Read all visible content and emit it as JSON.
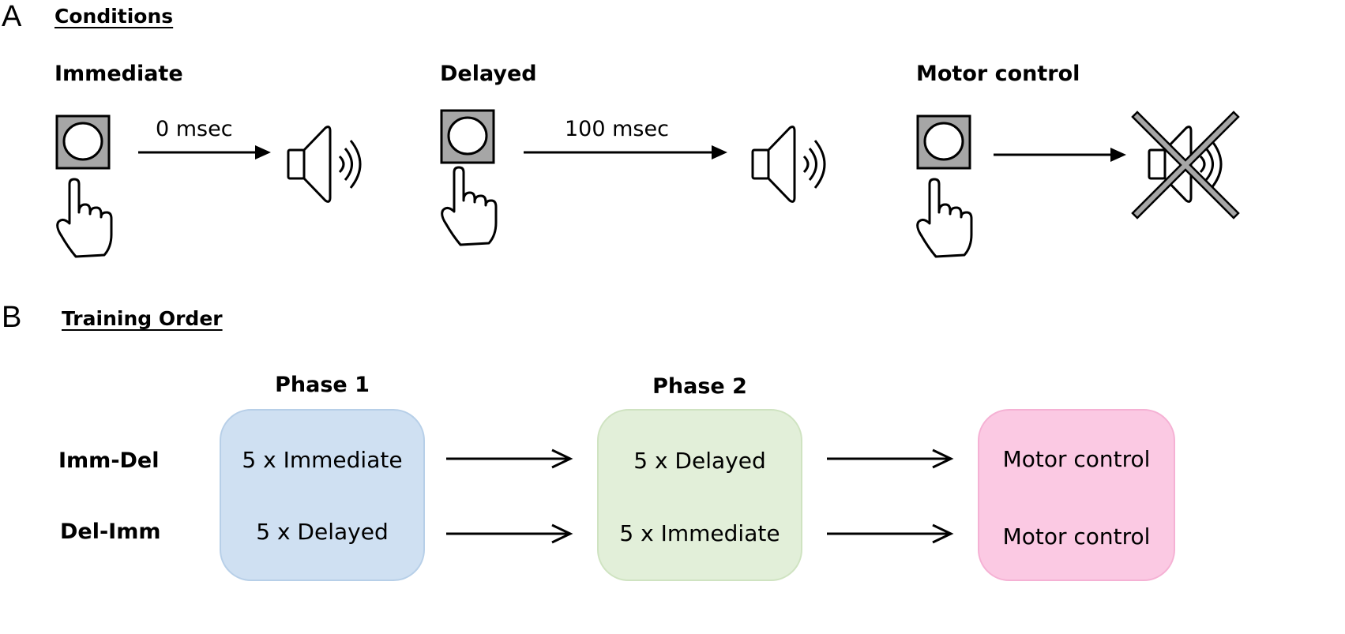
{
  "panel_a": {
    "letter": "A",
    "title": "Conditions",
    "conditions": [
      {
        "title": "Immediate",
        "delay_label": "0 msec",
        "button_icon": "button-icon",
        "hand_icon": "pointing-hand-icon",
        "output_icon": "speaker-icon",
        "sound_muted": false
      },
      {
        "title": "Delayed",
        "delay_label": "100 msec",
        "button_icon": "button-icon",
        "hand_icon": "pointing-hand-icon",
        "output_icon": "speaker-icon",
        "sound_muted": false
      },
      {
        "title": "Motor control",
        "delay_label": "",
        "button_icon": "button-icon",
        "hand_icon": "pointing-hand-icon",
        "output_icon": "speaker-muted-icon",
        "sound_muted": true
      }
    ]
  },
  "panel_b": {
    "letter": "B",
    "title": "Training Order",
    "phases": [
      {
        "title": "Phase 1",
        "color": "#cfe0f2",
        "border": "#b7cfe8",
        "rows": [
          "5 x Immediate",
          "5 x Delayed"
        ]
      },
      {
        "title": "Phase 2",
        "color": "#e2efd9",
        "border": "#cfe3c1",
        "rows": [
          "5 x Delayed",
          "5 x Immediate"
        ]
      },
      {
        "title": "",
        "color": "#fbc9e3",
        "border": "#f5b1d4",
        "rows": [
          "Motor control",
          "Motor control"
        ]
      }
    ],
    "row_labels": [
      "Imm-Del",
      "Del-Imm"
    ]
  }
}
